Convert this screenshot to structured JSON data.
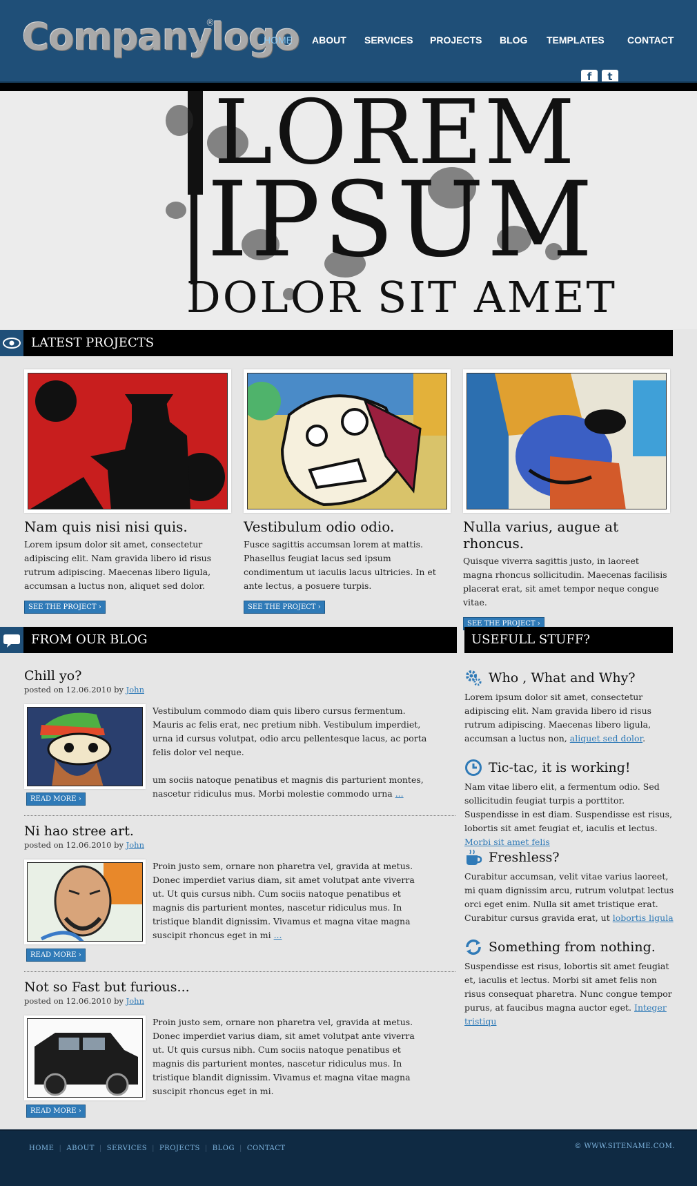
{
  "header": {
    "logo": "Companylogo",
    "logo_mark": "®",
    "nav": [
      "HOME",
      "ABOUT",
      "SERVICES",
      "PROJECTS",
      "BLOG",
      "TEMPLATES",
      "CONTACT"
    ],
    "active_nav": "HOME",
    "social": [
      {
        "name": "facebook-icon",
        "glyph": "f"
      },
      {
        "name": "twitter-icon",
        "glyph": "t"
      }
    ]
  },
  "hero": {
    "line1": "LOREM",
    "line2": "IPSUM",
    "line3": "DOLOR SIT AMET"
  },
  "projects": {
    "section_title": "LATEST PROJECTS",
    "icon": "eye-icon",
    "items": [
      {
        "title": "Nam quis nisi nisi quis.",
        "text": "Lorem ipsum dolor sit amet, consectetur adipiscing elit. Nam gravida libero id risus rutrum adipiscing. Maecenas libero ligula, accumsan a luctus non, aliquet sed dolor.",
        "button": "SEE THE PROJECT ›"
      },
      {
        "title": "Vestibulum odio odio.",
        "text": "Fusce sagittis accumsan lorem at mattis. Phasellus feugiat lacus sed ipsum condimentum ut iaculis lacus ultricies. In et ante lectus, a posuere turpis.",
        "button": "SEE THE PROJECT ›"
      },
      {
        "title": "Nulla varius, augue at rhoncus.",
        "text": "Quisque viverra sagittis justo, in laoreet magna rhoncus sollicitudin. Maecenas facilisis placerat erat, sit amet tempor neque congue vitae.",
        "button": "SEE THE PROJECT ›"
      }
    ]
  },
  "blog": {
    "section_title": "FROM OUR BLOG",
    "icon": "speech-bubble-icon",
    "posts": [
      {
        "title": "Chill yo?",
        "meta_prefix": "posted on 12.06.2010 by ",
        "author": "John",
        "para1": "Vestibulum commodo diam quis libero cursus fermentum. Mauris ac felis erat, nec pretium nibh. Vestibulum imperdiet, urna id cursus volutpat, odio arcu pellentesque lacus, ac porta felis dolor vel neque.",
        "para2": "um sociis natoque penatibus et magnis dis parturient montes, nascetur ridiculus mus. Morbi molestie commodo urna ",
        "more_link": "...",
        "button": "READ MORE ›"
      },
      {
        "title": "Ni hao stree art.",
        "meta_prefix": "posted on 12.06.2010 by ",
        "author": "John",
        "para1": "Proin justo sem, ornare non pharetra vel, gravida at metus. Donec imperdiet varius diam, sit amet volutpat ante viverra ut. Ut quis cursus nibh. Cum sociis natoque penatibus et magnis dis parturient montes, nascetur ridiculus mus. In tristique blandit dignissim. Vivamus et magna vitae magna suscipit rhoncus eget in mi ",
        "more_link": "...",
        "button": "READ MORE ›"
      },
      {
        "title": "Not so Fast but furious...",
        "meta_prefix": "posted on 12.06.2010 by ",
        "author": "John",
        "para1": "Proin justo sem, ornare non pharetra vel, gravida at metus. Donec imperdiet varius diam, sit amet volutpat ante viverra ut. Ut quis cursus nibh. Cum sociis natoque penatibus et magnis dis parturient montes, nascetur ridiculus mus. In tristique blandit dignissim. Vivamus et magna vitae magna suscipit rhoncus eget in mi.",
        "button": "READ MORE ›"
      }
    ]
  },
  "sidebar": {
    "section_title": "USEFULL STUFF?",
    "items": [
      {
        "icon": "gears-icon",
        "title": "Who , What and Why?",
        "text": "Lorem ipsum dolor sit amet, consectetur adipiscing elit. Nam gravida libero id risus rutrum adipiscing. Maecenas libero ligula, accumsan a luctus non, ",
        "link": "aliquet sed dolor",
        "tail": "."
      },
      {
        "icon": "clock-icon",
        "title": "Tic-tac, it is working!",
        "text": "Nam vitae libero elit, a fermentum odio. Sed sollicitudin feugiat turpis a porttitor. Suspendisse in est diam. Suspendisse est risus, lobortis sit amet feugiat et, iaculis et lectus. ",
        "link": "Morbi sit amet felis",
        "tail": ""
      },
      {
        "icon": "coffee-cup-icon",
        "title": "Freshless?",
        "text": "Curabitur accumsan, velit vitae varius laoreet, mi quam dignissim arcu, rutrum volutpat lectus orci eget enim. Nulla sit amet tristique erat. Curabitur cursus gravida erat, ut ",
        "link": "lobortis ligula",
        "tail": ""
      },
      {
        "icon": "refresh-icon",
        "title": "Something from nothing.",
        "text": "Suspendisse est risus, lobortis sit amet feugiat et, iaculis et lectus. Morbi sit amet felis non risus consequat pharetra. Nunc congue tempor purus, at faucibus magna auctor eget. ",
        "link": "Integer tristiqu",
        "tail": ""
      }
    ]
  },
  "footer": {
    "nav": [
      "HOME",
      "ABOUT",
      "SERVICES",
      "PROJECTS",
      "BLOG",
      "CONTACT"
    ],
    "copyright": "© WWW.SITENAME.COM."
  },
  "colors": {
    "header_bg": "#1f4f78",
    "accent": "#2f7ab7",
    "footer_bg": "#0f2a43",
    "active_nav": "#8ec8ef"
  }
}
